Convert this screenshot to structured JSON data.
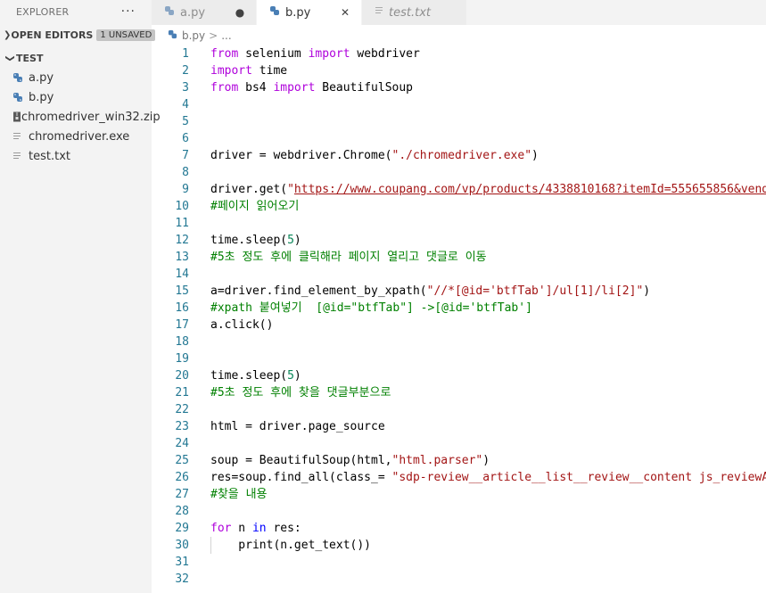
{
  "sidebar": {
    "title": "EXPLORER",
    "more_label": "···",
    "open_editors": {
      "label": "OPEN EDITORS",
      "badge": "1 UNSAVED"
    },
    "folder": {
      "label": "TEST"
    },
    "files": [
      {
        "name": "a.py",
        "icon": "python-icon"
      },
      {
        "name": "b.py",
        "icon": "python-icon"
      },
      {
        "name": "chromedriver_win32.zip",
        "icon": "zip-icon"
      },
      {
        "name": "chromedriver.exe",
        "icon": "file-lines-icon"
      },
      {
        "name": "test.txt",
        "icon": "file-lines-icon"
      }
    ]
  },
  "tabs": [
    {
      "label": "a.py",
      "icon": "python-icon",
      "status": "●"
    },
    {
      "label": "b.py",
      "icon": "python-icon",
      "status": "✕"
    },
    {
      "label": "test.txt",
      "icon": "file-lines-icon",
      "status": ""
    }
  ],
  "breadcrumb": {
    "file": "b.py",
    "separator": ">",
    "rest": "..."
  },
  "colors": {
    "keyword": "#af00db",
    "keyword2": "#0000ff",
    "string": "#a31515",
    "number": "#098658",
    "comment": "#008000",
    "function": "#795e26",
    "variable": "#001080",
    "class": "#267f99",
    "line_number": "#237893"
  },
  "editor": {
    "lines": [
      {
        "n": "1",
        "tokens": [
          [
            "kw",
            "from"
          ],
          [
            "p",
            " selenium "
          ],
          [
            "kw",
            "import"
          ],
          [
            "p",
            " webdriver"
          ]
        ]
      },
      {
        "n": "2",
        "tokens": [
          [
            "kw",
            "import"
          ],
          [
            "p",
            " time"
          ]
        ]
      },
      {
        "n": "3",
        "tokens": [
          [
            "kw",
            "from"
          ],
          [
            "p",
            " bs4 "
          ],
          [
            "kw",
            "import"
          ],
          [
            "p",
            " BeautifulSoup"
          ]
        ]
      },
      {
        "n": "4",
        "tokens": []
      },
      {
        "n": "5",
        "tokens": []
      },
      {
        "n": "6",
        "tokens": []
      },
      {
        "n": "7",
        "tokens": [
          [
            "p",
            "driver = webdriver.Chrome("
          ],
          [
            "str",
            "\"./chromedriver.exe\""
          ],
          [
            "p",
            ")"
          ]
        ]
      },
      {
        "n": "8",
        "tokens": []
      },
      {
        "n": "9",
        "tokens": [
          [
            "p",
            "driver.get("
          ],
          [
            "str",
            "\""
          ],
          [
            "url",
            "https://www.coupang.com/vp/products/4338810168?itemId=555655856&vendo"
          ]
        ]
      },
      {
        "n": "10",
        "tokens": [
          [
            "com",
            "#페이지 읽어오기"
          ]
        ]
      },
      {
        "n": "11",
        "tokens": []
      },
      {
        "n": "12",
        "tokens": [
          [
            "p",
            "time.sleep("
          ],
          [
            "num",
            "5"
          ],
          [
            "p",
            ")"
          ]
        ]
      },
      {
        "n": "13",
        "tokens": [
          [
            "com",
            "#5초 정도 후에 클릭해라 페이지 열리고 댓글로 이동"
          ]
        ]
      },
      {
        "n": "14",
        "tokens": []
      },
      {
        "n": "15",
        "tokens": [
          [
            "p",
            "a=driver.find_element_by_xpath("
          ],
          [
            "str",
            "\"//*[@id='btfTab']/ul[1]/li[2]\""
          ],
          [
            "p",
            ")"
          ]
        ]
      },
      {
        "n": "16",
        "tokens": [
          [
            "com",
            "#xpath 붙여넣기  [@id=\"btfTab\"] ->[@id='btfTab']"
          ]
        ]
      },
      {
        "n": "17",
        "tokens": [
          [
            "p",
            "a.click()"
          ]
        ]
      },
      {
        "n": "18",
        "tokens": []
      },
      {
        "n": "19",
        "tokens": []
      },
      {
        "n": "20",
        "tokens": [
          [
            "p",
            "time.sleep("
          ],
          [
            "num",
            "5"
          ],
          [
            "p",
            ")"
          ]
        ]
      },
      {
        "n": "21",
        "tokens": [
          [
            "com",
            "#5초 정도 후에 찾을 댓글부분으로"
          ]
        ]
      },
      {
        "n": "22",
        "tokens": []
      },
      {
        "n": "23",
        "tokens": [
          [
            "p",
            "html = driver.page_source"
          ]
        ]
      },
      {
        "n": "24",
        "tokens": []
      },
      {
        "n": "25",
        "tokens": [
          [
            "p",
            "soup = BeautifulSoup(html,"
          ],
          [
            "str",
            "\"html.parser\""
          ],
          [
            "p",
            ")"
          ]
        ]
      },
      {
        "n": "26",
        "tokens": [
          [
            "p",
            "res=soup.find_all(class_= "
          ],
          [
            "str",
            "\"sdp-review__article__list__review__content js_reviewAr"
          ]
        ]
      },
      {
        "n": "27",
        "tokens": [
          [
            "com",
            "#찾을 내용"
          ]
        ]
      },
      {
        "n": "28",
        "tokens": []
      },
      {
        "n": "29",
        "tokens": [
          [
            "kw",
            "for"
          ],
          [
            "p",
            " n "
          ],
          [
            "kw2",
            "in"
          ],
          [
            "p",
            " res:"
          ]
        ]
      },
      {
        "n": "30",
        "tokens": [
          [
            "p",
            "    print(n.get_text())"
          ]
        ],
        "indent": true
      },
      {
        "n": "31",
        "tokens": []
      },
      {
        "n": "32",
        "tokens": []
      }
    ]
  }
}
